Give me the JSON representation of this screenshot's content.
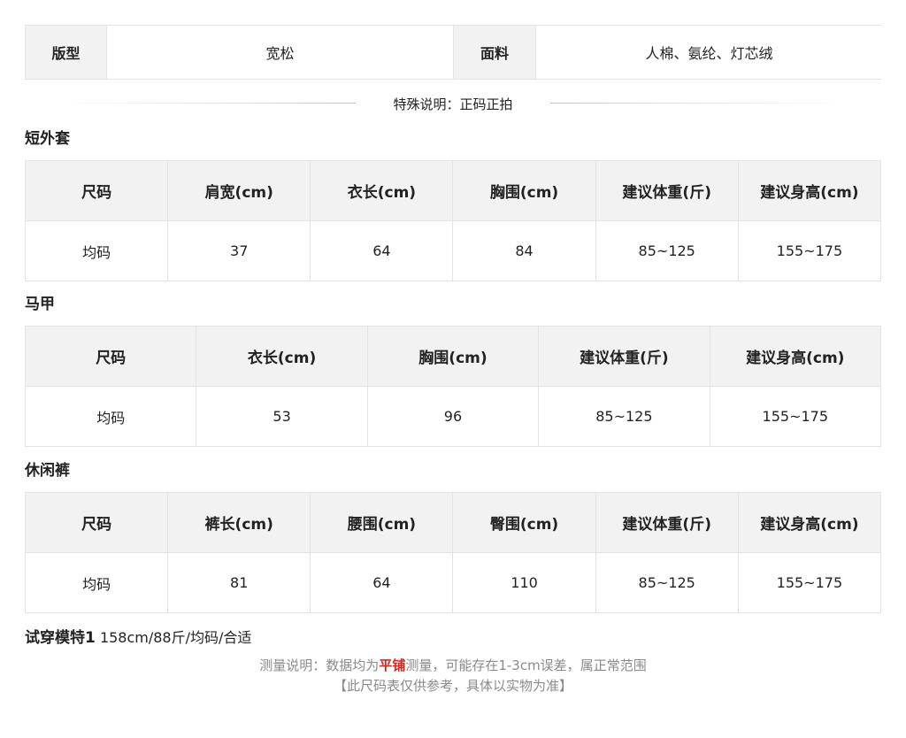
{
  "info": {
    "fit_label": "版型",
    "fit_value": "宽松",
    "fabric_label": "面料",
    "fabric_value": "人棉、氨纶、灯芯绒"
  },
  "special_note": "特殊说明：正码正拍",
  "jacket": {
    "title": "短外套",
    "headers": [
      "尺码",
      "肩宽(cm)",
      "衣长(cm)",
      "胸围(cm)",
      "建议体重(斤)",
      "建议身高(cm)"
    ],
    "row": [
      "均码",
      "37",
      "64",
      "84",
      "85~125",
      "155~175"
    ]
  },
  "vest": {
    "title": "马甲",
    "headers": [
      "尺码",
      "衣长(cm)",
      "胸围(cm)",
      "建议体重(斤)",
      "建议身高(cm)"
    ],
    "row": [
      "均码",
      "53",
      "96",
      "85~125",
      "155~175"
    ]
  },
  "pants": {
    "title": "休闲裤",
    "headers": [
      "尺码",
      "裤长(cm)",
      "腰围(cm)",
      "臀围(cm)",
      "建议体重(斤)",
      "建议身高(cm)"
    ],
    "row": [
      "均码",
      "81",
      "64",
      "110",
      "85~125",
      "155~175"
    ]
  },
  "model": {
    "label": "试穿模特1",
    "value": "158cm/88斤/均码/合适"
  },
  "measure_note": {
    "before": "测量说明：数据均为",
    "highlight": "平铺",
    "after": "测量，可能存在1-3cm误差，属正常范围",
    "line2": "【此尺码表仅供参考，具体以实物为准】",
    "highlight_color": "#e0201b"
  }
}
